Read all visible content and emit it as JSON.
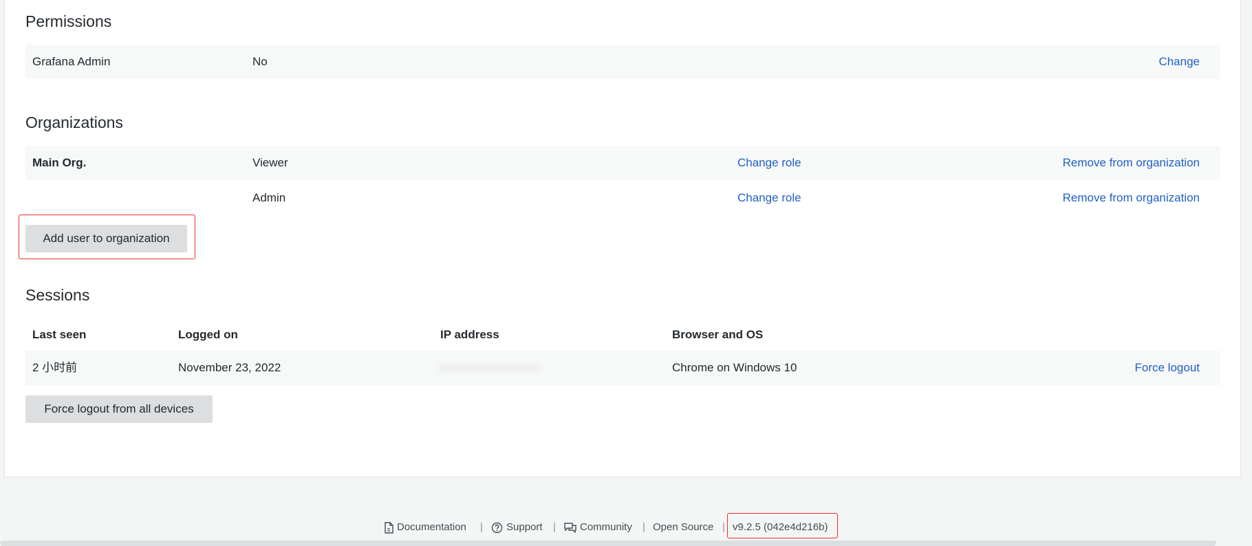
{
  "permissions": {
    "title": "Permissions",
    "row": {
      "label": "Grafana Admin",
      "value": "No",
      "action": "Change"
    }
  },
  "organizations": {
    "title": "Organizations",
    "rows": [
      {
        "org": "Main Org.",
        "role": "Viewer",
        "change_role": "Change role",
        "remove": "Remove from organization"
      },
      {
        "org": "",
        "role": "Admin",
        "change_role": "Change role",
        "remove": "Remove from organization"
      }
    ],
    "add_button": "Add user to organization"
  },
  "sessions": {
    "title": "Sessions",
    "columns": [
      "Last seen",
      "Logged on",
      "IP address",
      "Browser and OS"
    ],
    "rows": [
      {
        "last_seen": "2 小时前",
        "logged_on": "November 23, 2022",
        "ip": "",
        "browser": "Chrome on Windows 10",
        "action": "Force logout"
      }
    ],
    "logout_all_button": "Force logout from all devices"
  },
  "footer": {
    "documentation": "Documentation",
    "support": "Support",
    "community": "Community",
    "open_source": "Open Source",
    "version": "v9.2.5 (042e4d216b)",
    "separator": "|"
  },
  "colors": {
    "link": "#1f60c4",
    "highlight": "#e8312d",
    "button_bg": "#dcdedf",
    "row_bg": "#f7f8f8"
  }
}
